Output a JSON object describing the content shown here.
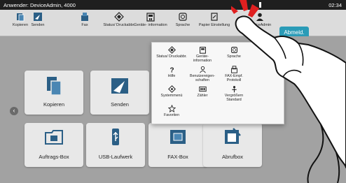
{
  "status_bar": {
    "user": "Anwender: DeviceAdmin, 4000",
    "time": "02:34"
  },
  "toolbar": {
    "items": [
      {
        "label": "Kopieren",
        "icon": "copy-icon"
      },
      {
        "label": "Senden",
        "icon": "send-icon"
      },
      {
        "label": "Fax",
        "icon": "fax-icon"
      },
      {
        "label": "Status/ Druckabbr.",
        "icon": "status-icon"
      },
      {
        "label": "Geräte- information",
        "icon": "device-info-icon"
      },
      {
        "label": "Sprache",
        "icon": "language-icon"
      },
      {
        "label": "Papier Einstellung",
        "icon": "paper-settings-icon"
      },
      {
        "label": "DeviceAdmin",
        "icon": "user-icon"
      }
    ],
    "logout_label": "Abmeld."
  },
  "home": {
    "tiles": [
      {
        "label": "Kopieren",
        "icon": "copy-icon"
      },
      {
        "label": "Senden",
        "icon": "send-icon"
      },
      {
        "label": "Auftrags-Box",
        "icon": "job-box-icon"
      },
      {
        "label": "USB-Laufwerk",
        "icon": "usb-icon"
      },
      {
        "label": "FAX-Box",
        "icon": "fax-box-icon"
      },
      {
        "label": "Abrufbox",
        "icon": "polling-box-icon"
      }
    ],
    "page_arrow": "‹"
  },
  "popup_menu": {
    "items": [
      {
        "label": "Status/ Druckabbr.",
        "icon": "status-icon"
      },
      {
        "label": "Geräte- information",
        "icon": "device-info-icon"
      },
      {
        "label": "Sprache",
        "icon": "language-icon"
      },
      {
        "label": "Hilfe",
        "icon": "help-icon"
      },
      {
        "label": "Benutzereigen- schaften",
        "icon": "user-properties-icon"
      },
      {
        "label": "FAX-Empf. Protokoll",
        "icon": "fax-log-icon"
      },
      {
        "label": "Systemmenü",
        "icon": "system-menu-icon"
      },
      {
        "label": "Zähler",
        "icon": "counter-icon"
      },
      {
        "label": "Vergrößern Standard",
        "icon": "magnify-icon"
      },
      {
        "label": "Favoriten",
        "icon": "favorites-icon"
      }
    ]
  },
  "colors": {
    "accent": "#2a9bb7",
    "alert": "#e02020",
    "icon_blue": "#2b5f86"
  }
}
